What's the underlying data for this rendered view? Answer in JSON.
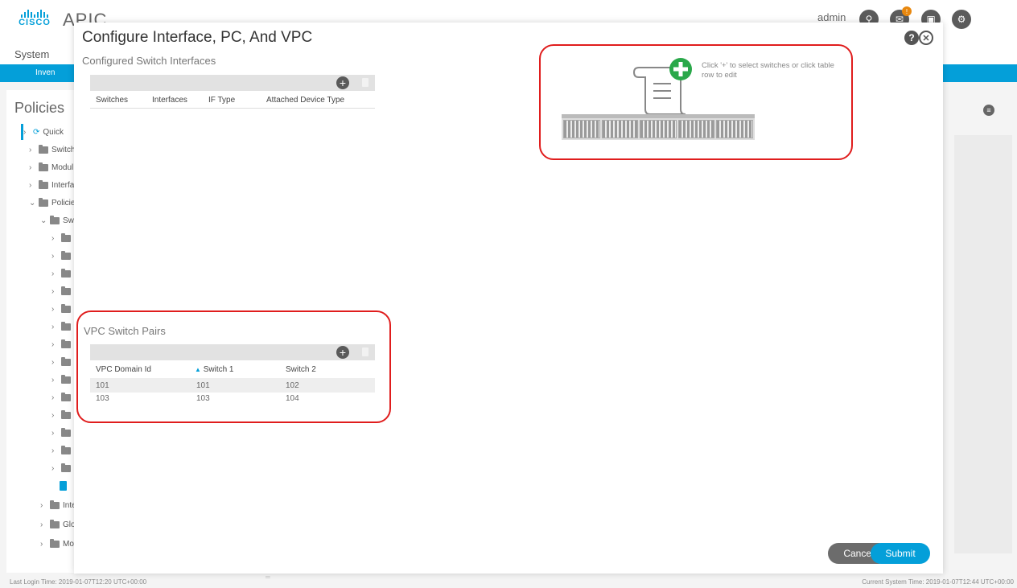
{
  "app": {
    "logo_text": "CISCO",
    "name": "APIC",
    "user": "admin",
    "nav_item": "System",
    "subnav_item": "Inven",
    "colors": {
      "accent": "#049fd9",
      "alert": "#e8870e",
      "highlight": "#e01d1d"
    }
  },
  "left_panel": {
    "title": "Policies",
    "items": [
      {
        "label": "Quick",
        "icon": "quick-start-icon"
      },
      {
        "label": "Switch",
        "icon": "folder-icon"
      },
      {
        "label": "Modul",
        "icon": "folder-icon"
      },
      {
        "label": "Interfa",
        "icon": "folder-icon"
      },
      {
        "label": "Policie",
        "icon": "folder-icon"
      },
      {
        "label": "Sw",
        "icon": "folder-icon"
      },
      {
        "label": "Inte",
        "icon": "folder-icon"
      },
      {
        "label": "Glo",
        "icon": "folder-icon"
      },
      {
        "label": "Mo",
        "icon": "folder-icon"
      }
    ]
  },
  "modal": {
    "title": "Configure Interface, PC, And VPC",
    "help_icon": "help-icon",
    "close_icon": "close-icon",
    "configured": {
      "title": "Configured Switch Interfaces",
      "columns": [
        "Switches",
        "Interfaces",
        "IF Type",
        "Attached Device Type"
      ]
    },
    "hint": "Click '+' to select switches or click table row to edit",
    "vpc": {
      "title": "VPC Switch Pairs",
      "columns": [
        "VPC Domain Id",
        "Switch 1",
        "Switch 2"
      ],
      "sort_indicator": "▲",
      "rows": [
        [
          "101",
          "101",
          "102"
        ],
        [
          "103",
          "103",
          "104"
        ]
      ]
    },
    "cancel_label": "Cancel",
    "submit_label": "Submit"
  },
  "footer": {
    "last_login": "Last Login Time: 2019-01-07T12:20 UTC+00:00",
    "current_time": "Current System Time: 2019-01-07T12:44 UTC+00:00"
  }
}
